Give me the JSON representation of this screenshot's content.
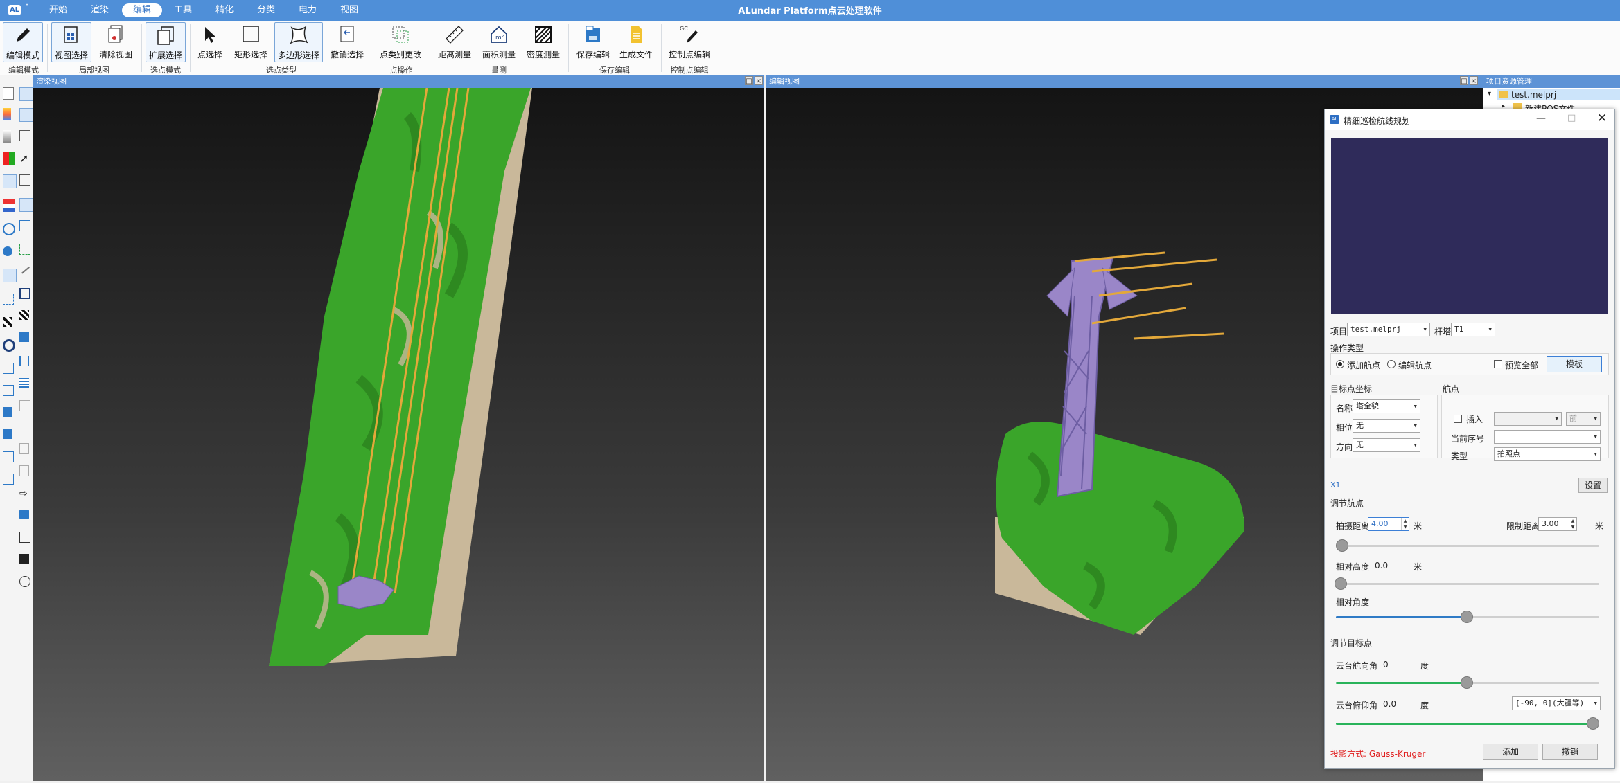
{
  "app": {
    "title": "ALundar Platform点云处理软件",
    "logo": "AL",
    "menu": [
      "开始",
      "渲染",
      "编辑",
      "工具",
      "精化",
      "分类",
      "电力",
      "视图"
    ],
    "menu_active": "编辑"
  },
  "ribbon": {
    "buttons": {
      "edit_mode": "编辑模式",
      "view_select": "视图选择",
      "clear_view": "清除视图",
      "expand_select": "扩展选择",
      "point_select": "点选择",
      "rect_select": "矩形选择",
      "poly_select": "多边形选择",
      "undo_select": "撤销选择",
      "class_change": "点类别更改",
      "dist_measure": "距离测量",
      "area_measure": "面积测量",
      "density_measure": "密度测量",
      "save_edit": "保存编辑",
      "gen_file": "生成文件",
      "ctrl_edit": "控制点编辑"
    },
    "groups": {
      "edit_mode": "编辑模式",
      "local_view": "局部视图",
      "select_mode": "选点模式",
      "select_type": "选点类型",
      "point_ops": "点操作",
      "measure": "量测",
      "save_edit": "保存编辑",
      "ctrl_edit": "控制点编辑"
    }
  },
  "views": {
    "left_title": "渲染视图",
    "right_title": "编辑视图"
  },
  "resources": {
    "title": "项目资源管理",
    "root": "test.melprj",
    "child": "新建POS文件"
  },
  "dialog": {
    "title": "精细巡检航线规划",
    "project_label": "项目",
    "project_value": "test.melprj",
    "tower_label": "杆塔",
    "tower_value": "T1",
    "op_type_label": "操作类型",
    "add_waypoint": "添加航点",
    "edit_waypoint": "编辑航点",
    "preview_all": "预览全部",
    "template_button": "模板",
    "target_coords_label": "目标点坐标",
    "waypoint_label": "航点",
    "name_label": "名称",
    "name_value": "塔全貌",
    "phase_label": "相位",
    "phase_value": "无",
    "direction_label": "方向",
    "direction_value": "无",
    "insert_label": "插入",
    "before_value": "前",
    "current_index_label": "当前序号",
    "type_label": "类型",
    "type_value": "拍照点",
    "x1_label": "X1",
    "settings_button": "设置",
    "adjust_waypoint_label": "调节航点",
    "shoot_distance_label": "拍摄距离",
    "shoot_distance_value": "4.00",
    "unit_m": "米",
    "limit_distance_label": "限制距离",
    "limit_distance_value": "3.00",
    "relative_height_label": "相对高度",
    "relative_height_value": "0.0",
    "relative_angle_label": "相对角度",
    "adjust_target_label": "调节目标点",
    "gimbal_heading_label": "云台航向角",
    "gimbal_heading_value": "0",
    "unit_deg": "度",
    "gimbal_pitch_label": "云台俯仰角",
    "gimbal_pitch_value": "0.0",
    "pitch_range_value": "[-90, 0](大疆等)",
    "projection_text": "投影方式: Gauss-Kruger",
    "add_button": "添加",
    "undo_button": "撤销"
  },
  "colors": {
    "title_bar": "#4f8fd8",
    "view_header": "#5d93d6",
    "vegetation": "#3aa52a",
    "tower": "#9a86c8",
    "wires": "#e3a83a",
    "preview_bg": "#2f2b5a",
    "projection_text": "#e02020"
  }
}
